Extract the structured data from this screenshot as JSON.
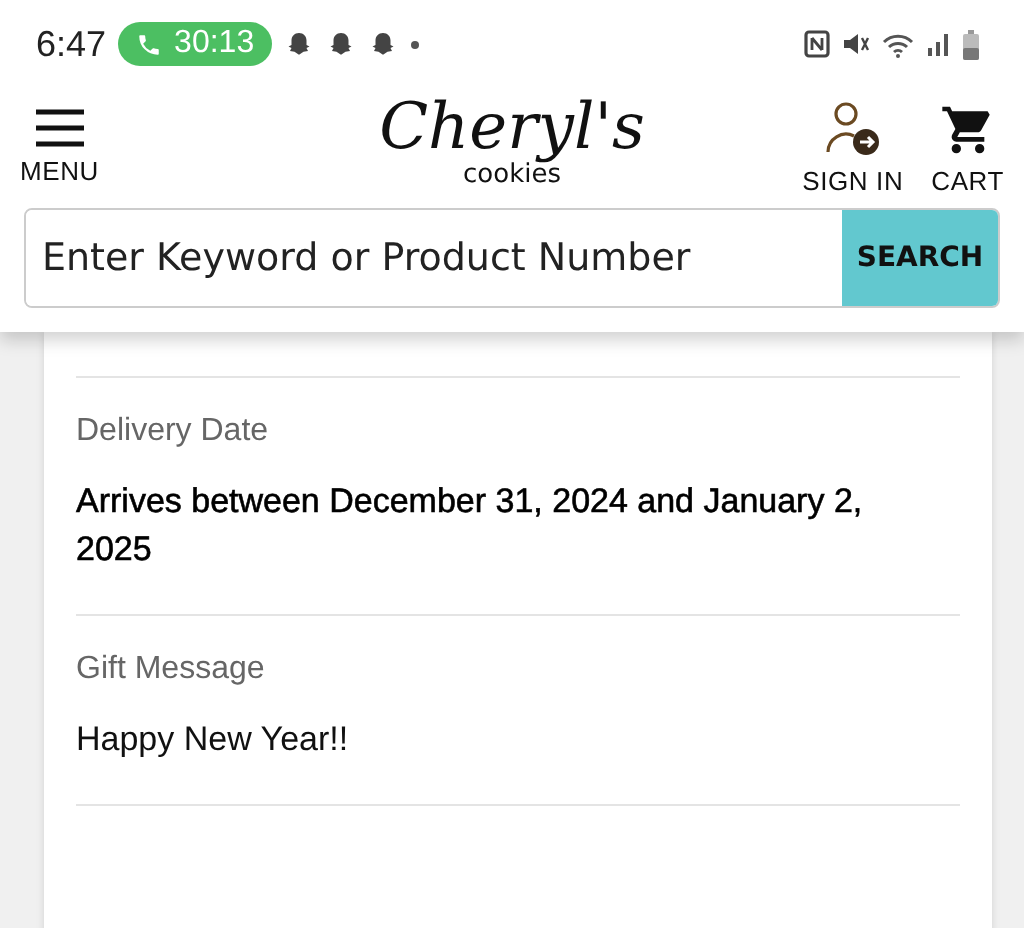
{
  "status_bar": {
    "time": "6:47",
    "call_timer": "30:13"
  },
  "header": {
    "menu_label": "MENU",
    "logo": {
      "name": "Cheryl's",
      "sub": "cookies"
    },
    "sign_in_label": "SIGN IN",
    "cart_label": "CART"
  },
  "search": {
    "placeholder": "Enter Keyword or Product Number",
    "button": "SEARCH"
  },
  "sections": [
    {
      "label": "Delivery Date",
      "value": "Arrives between December 31, 2024 and January 2, 2025",
      "kind": "emphasis"
    },
    {
      "label": "Gift Message",
      "value": "Happy New Year!!",
      "kind": "plain"
    }
  ]
}
